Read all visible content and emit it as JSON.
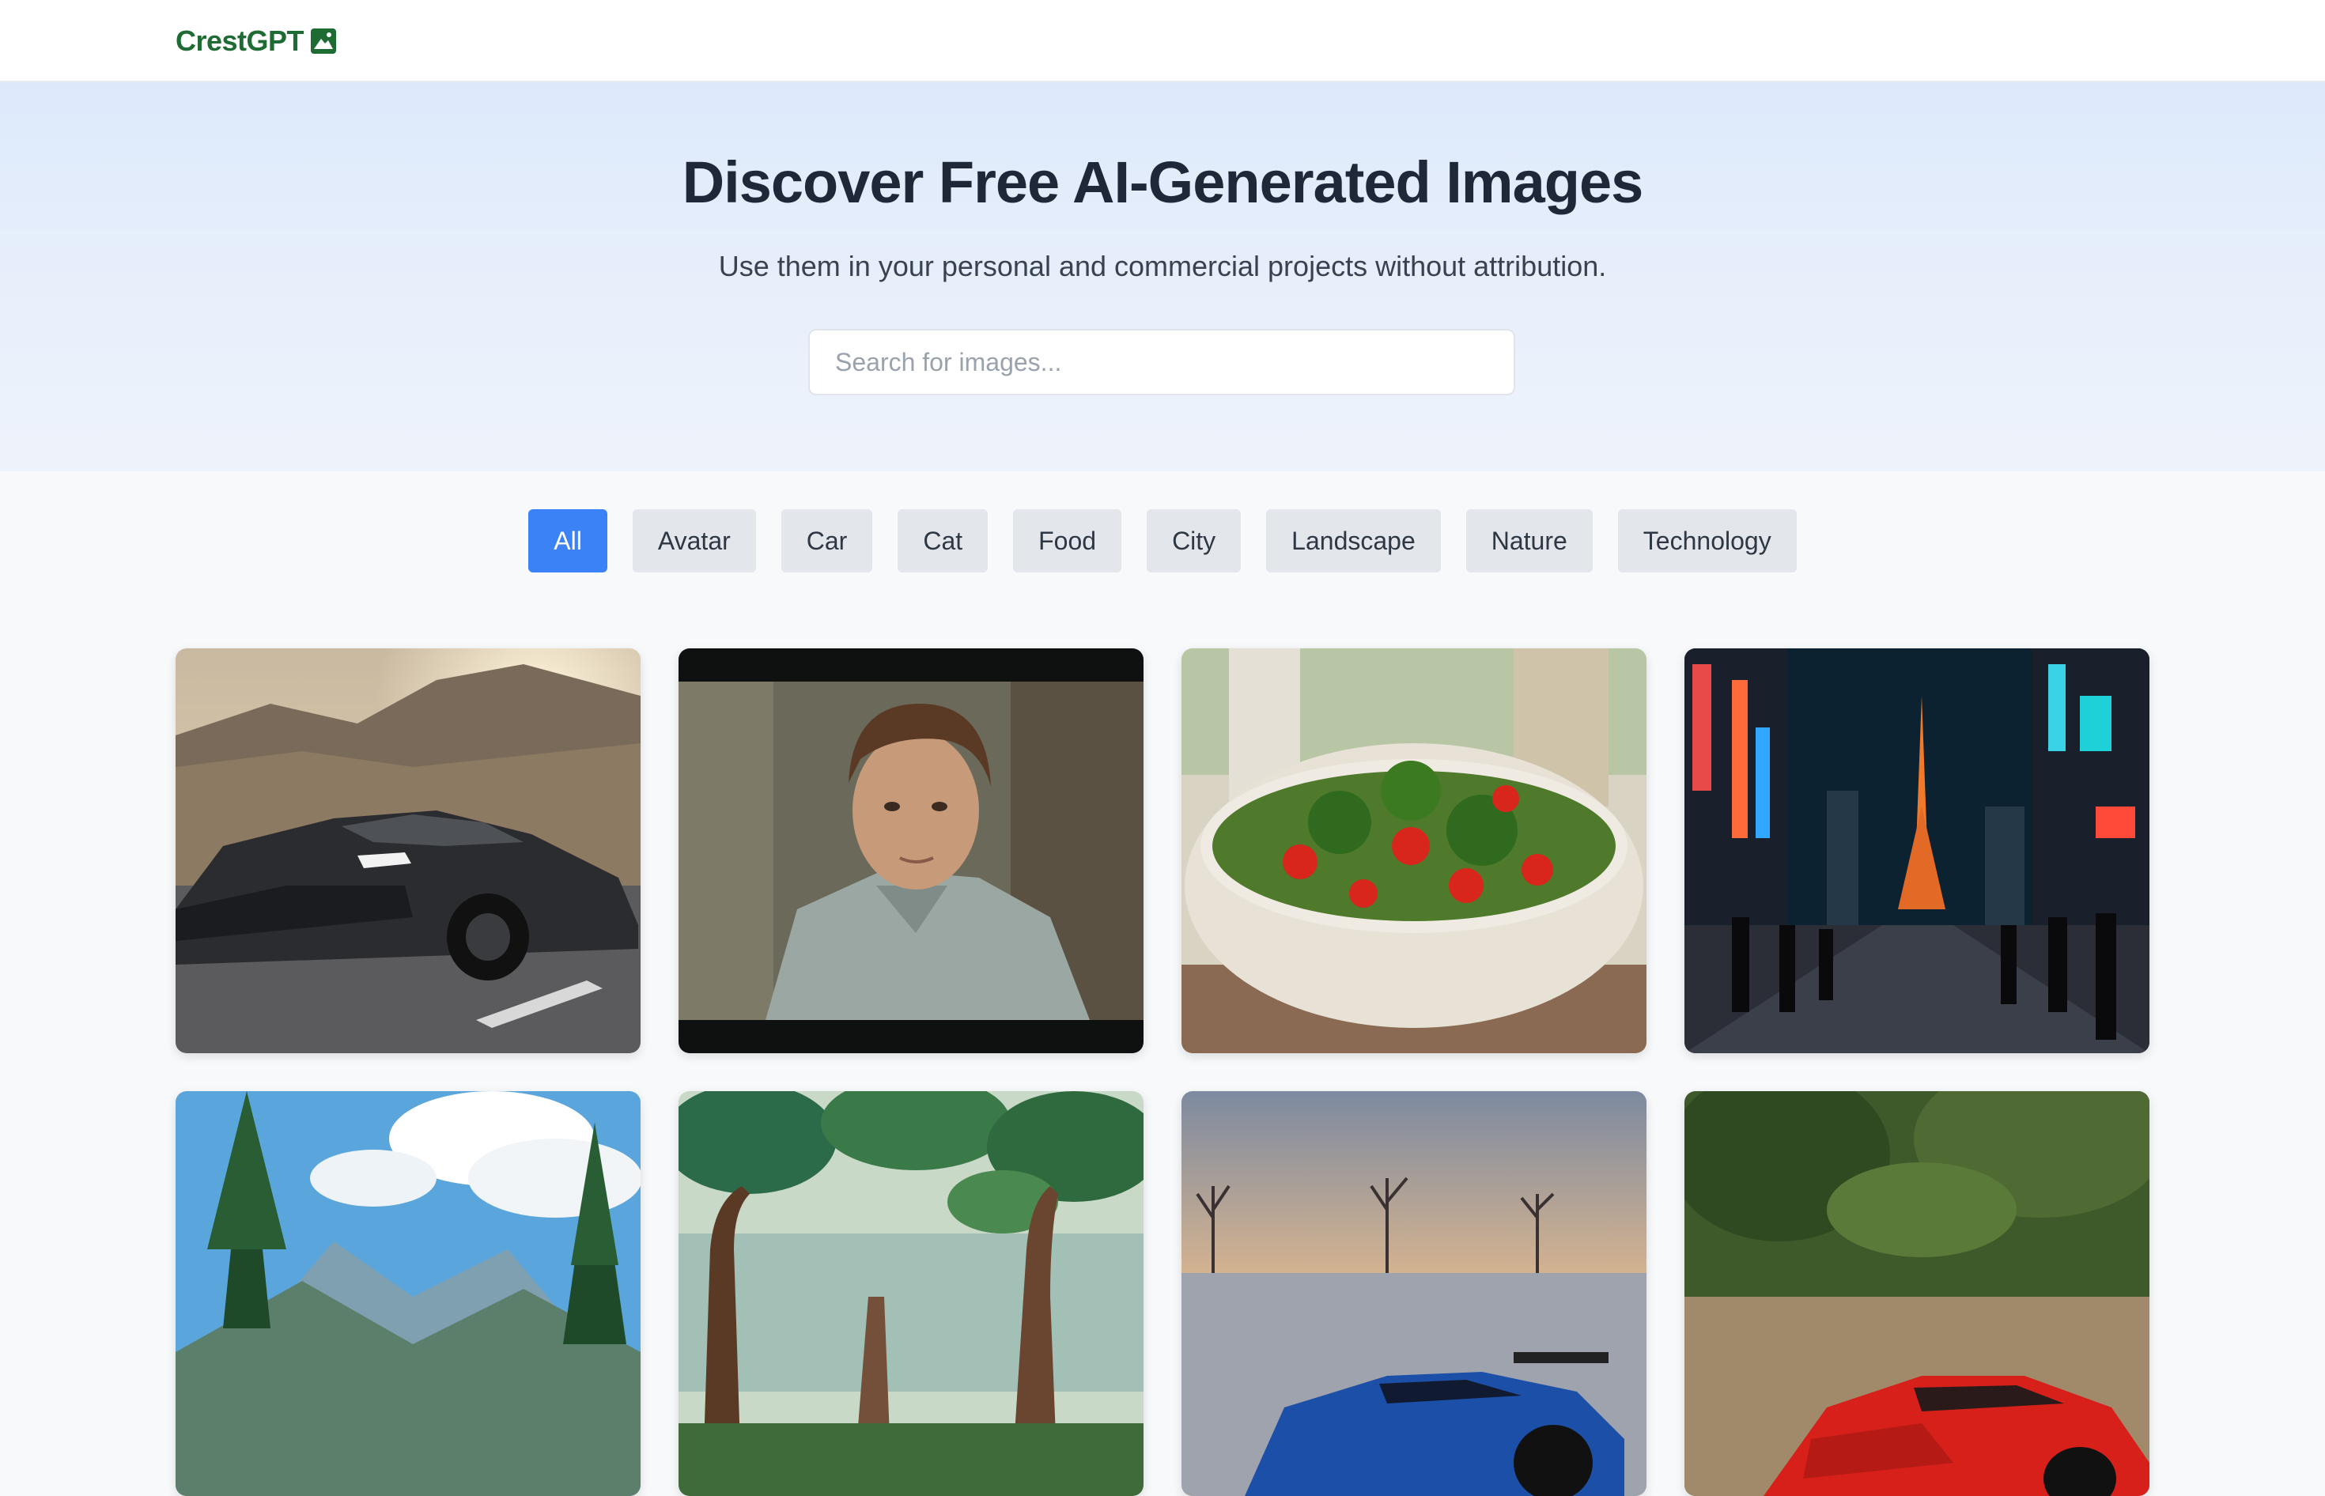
{
  "header": {
    "logo_text": "CrestGPT",
    "logo_icon": "mountain-image-icon",
    "brand_color": "#1f6b34"
  },
  "hero": {
    "title": "Discover Free AI-Generated Images",
    "subtitle": "Use them in your personal and commercial projects without attribution.",
    "search_placeholder": "Search for images...",
    "search_value": ""
  },
  "categories": {
    "active": "All",
    "active_color": "#3b82f6",
    "items": [
      "All",
      "Avatar",
      "Car",
      "Cat",
      "Food",
      "City",
      "Landscape",
      "Nature",
      "Technology"
    ]
  },
  "gallery": {
    "images": [
      {
        "subject": "dark sports car on mountain road at sunset"
      },
      {
        "subject": "portrait of man in striped shirt"
      },
      {
        "subject": "bowl of salad with broccoli and tomatoes"
      },
      {
        "subject": "neon city street at night with tower"
      },
      {
        "subject": "mountain valley with pine trees and clouds"
      },
      {
        "subject": "illustrated forest with tall trees"
      },
      {
        "subject": "blue hypercar in winter field at sunset"
      },
      {
        "subject": "red sports car on forest road"
      }
    ]
  }
}
